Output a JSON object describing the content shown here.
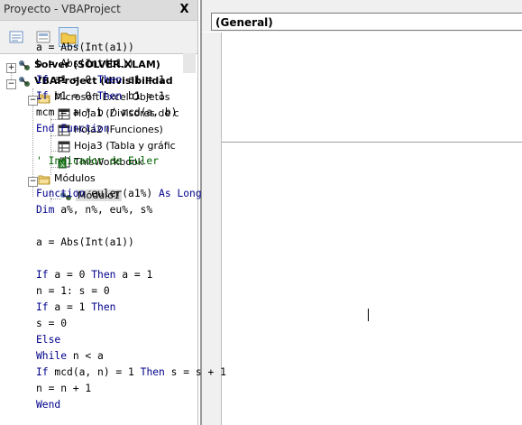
{
  "project_panel": {
    "title": "Proyecto - VBAProject",
    "close_label": "X",
    "tree": [
      {
        "label": "Solver (SOLVER.XLAM)"
      },
      {
        "label": "VBAProject (divisibilidad"
      },
      {
        "label": "Microsoft Excel Objetos"
      },
      {
        "label": "Hoja1 (Divisores de c"
      },
      {
        "label": "Hoja2 (Funciones)"
      },
      {
        "label": "Hoja3 (Tabla y gráfic"
      },
      {
        "label": "ThisWorkbook"
      },
      {
        "label": "Módulos"
      },
      {
        "label": "Módulo1"
      }
    ]
  },
  "code_window": {
    "object_dropdown": "(General)",
    "lines": [
      {
        "text": "a = Abs(Int(a1))"
      },
      {
        "text": "b = Abs(Int(b1))"
      },
      {
        "kw1": "If",
        "mid": " a1 = 0 ",
        "kw2": "Then",
        "rest": " a1 = 1"
      },
      {
        "kw1": "If",
        "mid": " b1 = 0 ",
        "kw2": "Then",
        "rest": " b1 = 1"
      },
      {
        "text": "mcm = a * b / mcd(a, b)"
      },
      {
        "kw": "End Function"
      },
      {
        "comment": "' Indicador de Euler"
      },
      {
        "kw1": "Function",
        "mid": " euler(a1%) ",
        "kw2": "As Long"
      },
      {
        "kw1": "Dim",
        "rest": " a%, n%, eu%, s%"
      },
      {
        "text": "a = Abs(Int(a1))"
      },
      {
        "kw1": "If",
        "mid": " a = 0 ",
        "kw2": "Then",
        "rest": " a = 1"
      },
      {
        "text": "n = 1: s = 0"
      },
      {
        "kw1": "If",
        "mid": " a = 1 ",
        "kw2": "Then"
      },
      {
        "text": "s = 0"
      },
      {
        "kw": "Else"
      },
      {
        "kw1": "While",
        "rest": " n < a"
      },
      {
        "kw1": "If",
        "mid": " mcd(a, n) = 1 ",
        "kw2": "Then",
        "rest": " s = s + 1"
      },
      {
        "text": "n = n + 1"
      },
      {
        "kw": "Wend"
      }
    ]
  }
}
